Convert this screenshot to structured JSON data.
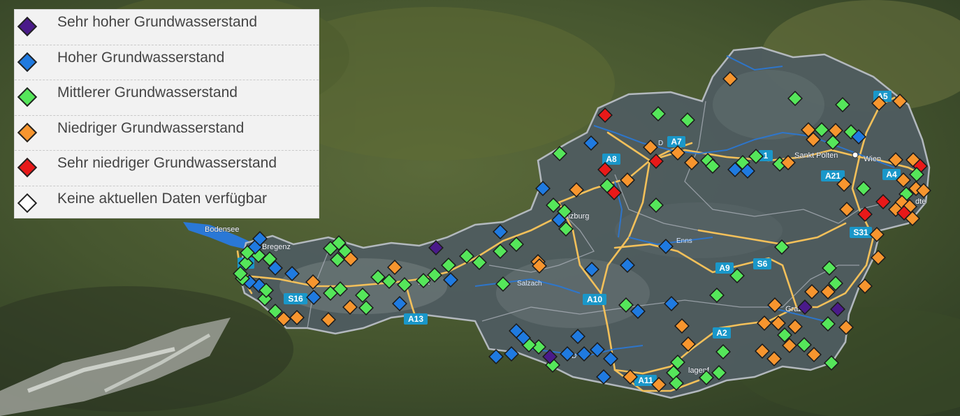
{
  "legend": {
    "items": [
      {
        "label": "Sehr hoher Grundwasserstand",
        "color": "#4a1a8a",
        "icon": "diamond-icon"
      },
      {
        "label": "Hoher Grundwasserstand",
        "color": "#1f7ae0",
        "icon": "diamond-icon"
      },
      {
        "label": "Mittlerer Grundwasserstand",
        "color": "#55e65a",
        "icon": "diamond-icon"
      },
      {
        "label": "Niedriger Grundwasserstand",
        "color": "#f7952e",
        "icon": "diamond-icon"
      },
      {
        "label": "Sehr niedriger Grundwasserstand",
        "color": "#e81919",
        "icon": "diamond-icon"
      },
      {
        "label": "Keine aktuellen Daten verfügbar",
        "color": "#ffffff",
        "icon": "diamond-icon"
      }
    ]
  },
  "map": {
    "places": {
      "bodensee": "Bodensee",
      "bregenz": "Bregenz",
      "salzburg": "Salzburg",
      "sankt_poelten": "Sankt Pölten",
      "wien": "Wien",
      "graz": "Graz",
      "klagenfurt": "lagenf",
      "innsbruck": "uck",
      "eisenstadt": "dte"
    },
    "rivers": {
      "enns": "Enns",
      "salzach": "Salzach",
      "donau": "D",
      "drau": "D"
    },
    "highways": {
      "a7": "A7",
      "a8": "A8",
      "a1": "1",
      "a5": "A5",
      "a4": "A4",
      "a21": "A21",
      "s31": "S31",
      "a9": "A9",
      "s6": "S6",
      "a10": "A10",
      "a2": "A2",
      "a11": "A11",
      "a13": "A13",
      "s16": "S16",
      "a14": "A1"
    },
    "colors": {
      "border": "#9aa0a8",
      "road": "#f3c05a",
      "water": "#2a78d6",
      "austria_fill": "#4b5a5e"
    }
  }
}
